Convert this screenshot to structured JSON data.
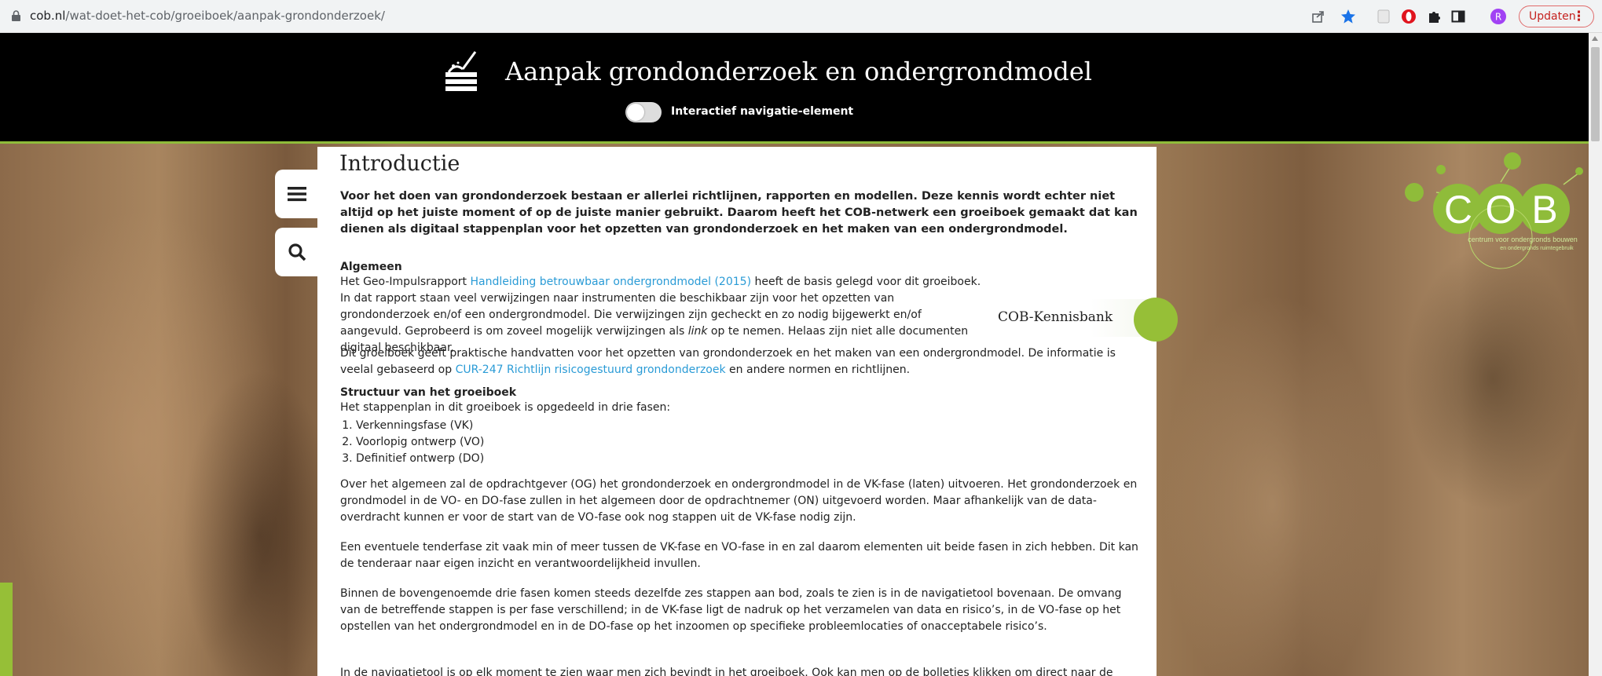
{
  "browser": {
    "url_host": "cob.nl",
    "url_path": "/wat-doet-het-cob/groeiboek/aanpak-grondonderzoek/",
    "update_label": "Updaten",
    "profile_initial": "R"
  },
  "header": {
    "title": "Aanpak grondonderzoek en ondergrondmodel",
    "toggle_label": "Interactief navigatie-element"
  },
  "sidebar_buttons": [
    "menu",
    "search"
  ],
  "content": {
    "heading": "Introductie",
    "intro": "Voor het doen van grondonderzoek bestaan er allerlei richtlijnen, rapporten en modellen. Deze kennis wordt echter niet altijd op het juiste moment of op de juiste manier gebruikt. Daarom heeft het COB-netwerk een groeiboek gemaakt dat kan dienen als digitaal stappenplan voor het opzetten van grondonderzoek en het maken van een ondergrondmodel.",
    "algemeen_title": "Algemeen",
    "algemeen_p1_a": "Het Geo-Impulsrapport ",
    "algemeen_p1_link": "Handleiding betrouwbaar ondergrondmodel (2015)",
    "algemeen_p1_b": " heeft de basis gelegd voor dit groeiboek.",
    "algemeen_p1_c": "In dat rapport staan veel verwijzingen naar instrumenten die beschikbaar zijn voor het opzetten van grondonderzoek en/of een ondergrondmodel. Die verwijzingen zijn gecheckt en zo nodig bijgewerkt en/of aangevuld. Geprobeerd is om zoveel mogelijk verwijzingen als ",
    "algemeen_p1_em": "link",
    "algemeen_p1_d": " op te nemen. Helaas zijn niet alle documenten digitaal beschikbaar.",
    "algemeen_p2_a": "Dit groeiboek geeft praktische handvatten voor het opzetten van grondonderzoek en het maken van een ondergrondmodel. De informatie is veelal gebaseerd op ",
    "algemeen_p2_link": "CUR-247 Richtlijn risicogestuurd grondonderzoek",
    "algemeen_p2_b": " en andere normen en richtlijnen.",
    "structuur_title": "Structuur van het groeiboek",
    "structuur_intro": "Het stappenplan in dit groeiboek is opgedeeld in drie fasen:",
    "phases": [
      "Verkenningsfase (VK)",
      "Voorlopig ontwerp (VO)",
      "Definitief ontwerp (DO)"
    ],
    "p_og": "Over het algemeen zal de opdrachtgever (OG) het grondonderzoek en ondergrondmodel in de VK-fase (laten) uitvoeren. Het grondonderzoek en grondmodel in de VO- en DO-fase zullen in het algemeen door de opdrachtnemer (ON) uitgevoerd worden. Maar afhankelijk van de data-overdracht kunnen er voor de start van de VO-fase ook nog stappen uit de VK-fase nodig zijn.",
    "p_tender": "Een eventuele tenderfase zit vaak min of meer tussen de VK-fase en VO-fase in en zal daarom elementen uit beide fasen in zich hebben. Dit kan de tenderaar naar eigen inzicht en verantwoordelijkheid invullen.",
    "p_binnen": "Binnen de bovengenoemde drie fasen komen steeds dezelfde zes stappen aan bod, zoals te zien is in de navigatietool bovenaan. De omvang van de betreffende stappen is per fase verschillend; in de VK-fase ligt de nadruk op het verzamelen van data en risico’s, in de VO-fase op het opstellen van het ondergrondmodel en in de DO-fase op het inzoomen op specifieke probleemlocaties of onacceptabele risico’s.",
    "p_cut": "In de navigatietool is op elk moment te zien waar men zich bevindt in het groeiboek. Ook kan men op de bolletjes klikken om direct naar de"
  },
  "kennisbank": {
    "label": "COB-Kennisbank"
  },
  "cob_logo": {
    "letters": [
      "C",
      "O",
      "B"
    ],
    "tagline_1": "centrum voor ondergronds bouwen",
    "tagline_2": "en ondergronds ruimtegebruik"
  },
  "colors": {
    "accent_green": "#96bf37",
    "link_blue": "#2a9bd6",
    "header_bg": "#000000"
  }
}
